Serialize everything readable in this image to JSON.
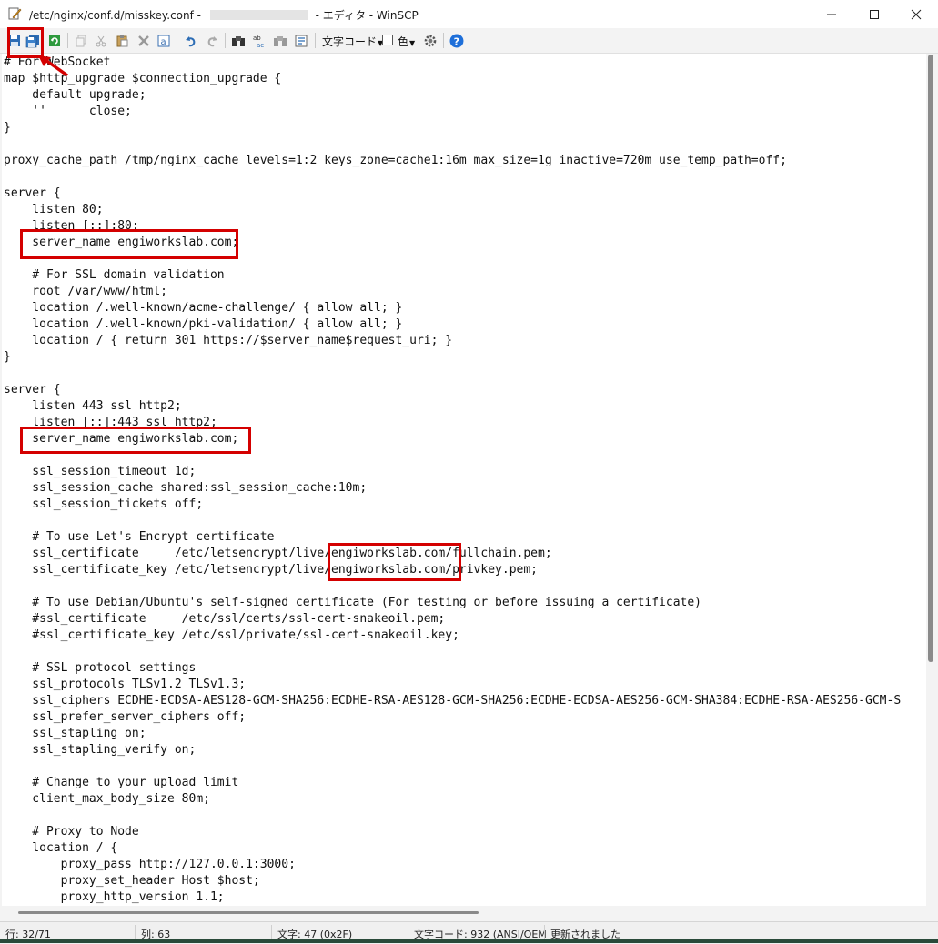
{
  "window": {
    "title_prefix": "/etc/nginx/conf.d/misskey.conf - ",
    "title_suffix": " - エディタ - WinSCP",
    "controls": [
      "minimize",
      "maximize",
      "close"
    ]
  },
  "toolbar": {
    "buttons": [
      "save",
      "save-all",
      "reload",
      "copy",
      "cut",
      "paste",
      "delete",
      "select-all",
      "undo",
      "redo",
      "find",
      "replace",
      "find-next",
      "goto-line"
    ],
    "encoding_label": "文字コード",
    "color_label": "色",
    "settings": "settings",
    "help": "help"
  },
  "editor": {
    "lines": [
      "# For WebSocket",
      "map $http_upgrade $connection_upgrade {",
      "    default upgrade;",
      "    ''      close;",
      "}",
      "",
      "proxy_cache_path /tmp/nginx_cache levels=1:2 keys_zone=cache1:16m max_size=1g inactive=720m use_temp_path=off;",
      "",
      "server {",
      "    listen 80;",
      "    listen [::]:80;",
      "    server_name engiworkslab.com;",
      "",
      "    # For SSL domain validation",
      "    root /var/www/html;",
      "    location /.well-known/acme-challenge/ { allow all; }",
      "    location /.well-known/pki-validation/ { allow all; }",
      "    location / { return 301 https://$server_name$request_uri; }",
      "}",
      "",
      "server {",
      "    listen 443 ssl http2;",
      "    listen [::]:443 ssl http2;",
      "    server_name engiworkslab.com;",
      "",
      "    ssl_session_timeout 1d;",
      "    ssl_session_cache shared:ssl_session_cache:10m;",
      "    ssl_session_tickets off;",
      "",
      "    # To use Let's Encrypt certificate",
      "    ssl_certificate     /etc/letsencrypt/live/engiworkslab.com/fullchain.pem;",
      "    ssl_certificate_key /etc/letsencrypt/live/engiworkslab.com/privkey.pem;",
      "",
      "    # To use Debian/Ubuntu's self-signed certificate (For testing or before issuing a certificate)",
      "    #ssl_certificate     /etc/ssl/certs/ssl-cert-snakeoil.pem;",
      "    #ssl_certificate_key /etc/ssl/private/ssl-cert-snakeoil.key;",
      "",
      "    # SSL protocol settings",
      "    ssl_protocols TLSv1.2 TLSv1.3;",
      "    ssl_ciphers ECDHE-ECDSA-AES128-GCM-SHA256:ECDHE-RSA-AES128-GCM-SHA256:ECDHE-ECDSA-AES256-GCM-SHA384:ECDHE-RSA-AES256-GCM-S",
      "    ssl_prefer_server_ciphers off;",
      "    ssl_stapling on;",
      "    ssl_stapling_verify on;",
      "",
      "    # Change to your upload limit",
      "    client_max_body_size 80m;",
      "",
      "    # Proxy to Node",
      "    location / {",
      "        proxy_pass http://127.0.0.1:3000;",
      "        proxy_set_header Host $host;",
      "        proxy_http_version 1.1;"
    ]
  },
  "status": {
    "line": "行: 32/71",
    "column": "列: 63",
    "char": "文字: 47 (0x2F)",
    "encoding": "文字コード: 932  (ANSI/OEM",
    "modified": "更新されました"
  },
  "colors": {
    "highlight": "#d40000",
    "help_blue": "#1e6fd9"
  }
}
